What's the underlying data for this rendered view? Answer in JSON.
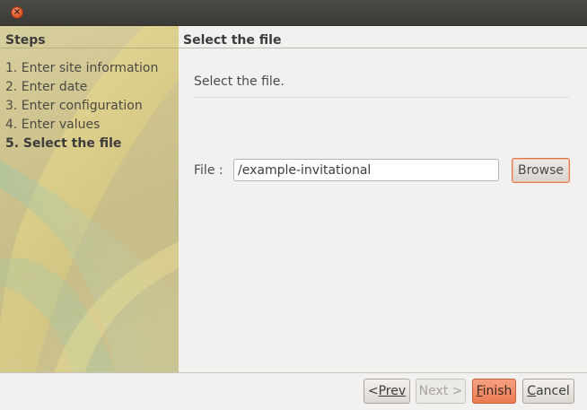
{
  "window": {
    "close_icon": "close-icon"
  },
  "steps": {
    "title": "Steps",
    "items": [
      {
        "label": "1. Enter site information"
      },
      {
        "label": "2. Enter date"
      },
      {
        "label": "3. Enter configuration"
      },
      {
        "label": "4. Enter values"
      },
      {
        "label": "5. Select the file"
      }
    ],
    "current_index": 4
  },
  "content": {
    "title": "Select the file",
    "description": "Select the file.",
    "file_label": "File :",
    "file_value": "/example-invitational",
    "browse_label": "Browse"
  },
  "footer": {
    "prev_first": "<",
    "prev_rest": "Prev",
    "next_label": "Next >",
    "finish_first": "F",
    "finish_rest": "inish",
    "cancel_first": "C",
    "cancel_rest": "ancel"
  },
  "colors": {
    "accent": "#ea7a52",
    "titlebar": "#3b3a36",
    "panel": "#cfc48e"
  }
}
